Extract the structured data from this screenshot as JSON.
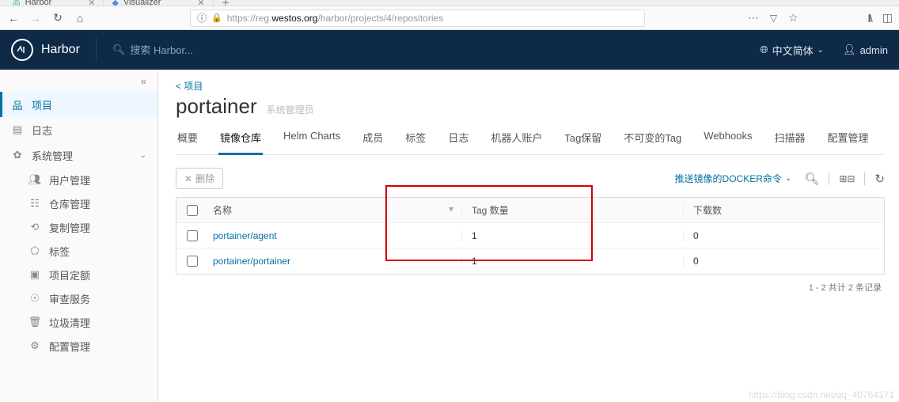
{
  "browser": {
    "tabs": [
      "Harbor",
      "Visualizer"
    ],
    "url_prefix": "https://reg.",
    "url_host": "westos.org",
    "url_path": "/harbor/projects/4/repositories"
  },
  "header": {
    "app_name": "Harbor",
    "search_placeholder": "搜索 Harbor...",
    "language": "中文简体",
    "username": "admin"
  },
  "sidebar": {
    "items": [
      {
        "label": "项目",
        "active": true
      },
      {
        "label": "日志"
      },
      {
        "label": "系统管理",
        "expandable": true
      }
    ],
    "sys_children": [
      {
        "label": "用户管理"
      },
      {
        "label": "仓库管理"
      },
      {
        "label": "复制管理"
      },
      {
        "label": "标签"
      },
      {
        "label": "项目定额"
      },
      {
        "label": "审查服务"
      },
      {
        "label": "垃圾清理"
      },
      {
        "label": "配置管理"
      }
    ]
  },
  "main": {
    "breadcrumb": "< 项目",
    "title": "portainer",
    "role": "系统管理员",
    "tabs": [
      "概要",
      "镜像仓库",
      "Helm Charts",
      "成员",
      "标签",
      "日志",
      "机器人账户",
      "Tag保留",
      "不可变的Tag",
      "Webhooks",
      "扫描器",
      "配置管理"
    ],
    "active_tab": 1,
    "delete_btn": "删除",
    "push_cmd": "推送镜像的DOCKER命令",
    "columns": {
      "name": "名称",
      "tags": "Tag 数量",
      "downloads": "下载数"
    },
    "rows": [
      {
        "name": "portainer/agent",
        "tags": "1",
        "downloads": "0"
      },
      {
        "name": "portainer/portainer",
        "tags": "1",
        "downloads": "0"
      }
    ],
    "footer": "1 - 2 共计 2 条记录"
  },
  "watermark": "https://blog.csdn.net/qq_40764171"
}
